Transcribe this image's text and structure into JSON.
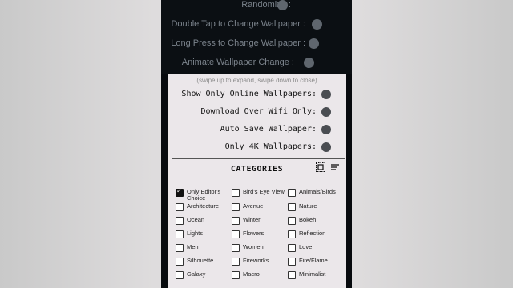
{
  "settings_top": {
    "randomize": {
      "label": "Randomize :",
      "enabled": false
    },
    "double_tap": {
      "label": "Double Tap to Change Wallpaper :",
      "enabled": false
    },
    "long_press": {
      "label": "Long Press to Change Wallpaper :",
      "enabled": false
    },
    "animate": {
      "label": "Animate Wallpaper Change :",
      "enabled": false
    }
  },
  "sheet": {
    "hint": "(swipe up to expand, swipe down to close)",
    "options": [
      {
        "label": "Show Only Online Wallpapers:",
        "enabled": false
      },
      {
        "label": "Download Over Wifi Only:",
        "enabled": false
      },
      {
        "label": "Auto Save Wallpaper:",
        "enabled": false
      },
      {
        "label": "Only 4K Wallpapers:",
        "enabled": false
      }
    ],
    "categories_title": "CATEGORIES",
    "icons": {
      "select_all": "select-all-icon",
      "sort": "sort-icon"
    },
    "categories": [
      {
        "label": "Only Editor's Choice",
        "checked": true
      },
      {
        "label": "Bird's Eye View",
        "checked": false
      },
      {
        "label": "Animals/Birds",
        "checked": false
      },
      {
        "label": "Architecture",
        "checked": false
      },
      {
        "label": "Avenue",
        "checked": false
      },
      {
        "label": "Nature",
        "checked": false
      },
      {
        "label": "Ocean",
        "checked": false
      },
      {
        "label": "Winter",
        "checked": false
      },
      {
        "label": "Bokeh",
        "checked": false
      },
      {
        "label": "Lights",
        "checked": false
      },
      {
        "label": "Flowers",
        "checked": false
      },
      {
        "label": "Reflection",
        "checked": false
      },
      {
        "label": "Men",
        "checked": false
      },
      {
        "label": "Women",
        "checked": false
      },
      {
        "label": "Love",
        "checked": false
      },
      {
        "label": "Silhouette",
        "checked": false
      },
      {
        "label": "Fireworks",
        "checked": false
      },
      {
        "label": "Fire/Flame",
        "checked": false
      },
      {
        "label": "Galaxy",
        "checked": false
      },
      {
        "label": "Macro",
        "checked": false
      },
      {
        "label": "Minimalist",
        "checked": false
      }
    ]
  }
}
